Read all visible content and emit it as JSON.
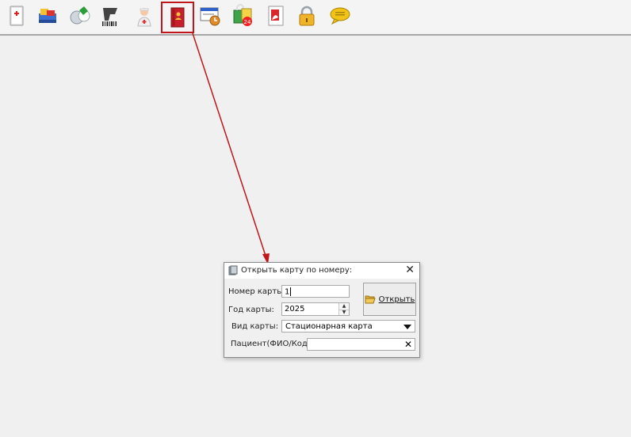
{
  "toolbar": {
    "buttons": [
      {
        "name": "first-aid-icon"
      },
      {
        "name": "medicines-icon"
      },
      {
        "name": "pills-icon"
      },
      {
        "name": "barcode-scanner-icon"
      },
      {
        "name": "nurse-icon"
      },
      {
        "name": "patient-card-icon"
      },
      {
        "name": "schedule-window-icon"
      },
      {
        "name": "calendar-24-icon"
      },
      {
        "name": "pdf-report-icon"
      },
      {
        "name": "lock-icon"
      },
      {
        "name": "message-icon"
      }
    ],
    "highlight_color": "#c0161c"
  },
  "dialog": {
    "title": "Открыть карту по номеру:",
    "close_label": "✕",
    "card_number_label": "Номер карты:",
    "card_number_value": "1",
    "card_year_label": "Год карты:",
    "card_year_value": "2025",
    "card_type_label": "Вид карты:",
    "card_type_value": "Стационарная карта",
    "patient_label": "Пациент(ФИО/Код):",
    "patient_value": "",
    "clear_label": "✕",
    "open_button_label": "Открыть"
  }
}
